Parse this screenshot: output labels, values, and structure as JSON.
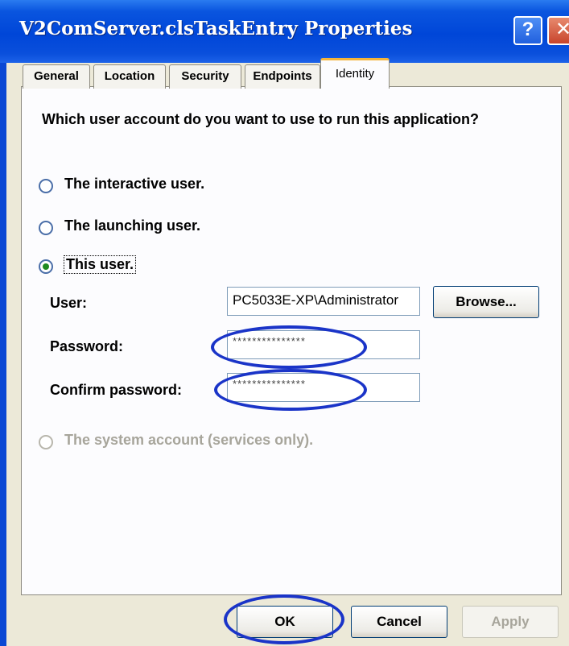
{
  "window": {
    "title": "V2ComServer.clsTaskEntry Properties",
    "help_label": "?",
    "close_label": "✕"
  },
  "tabs": [
    {
      "label": "General",
      "selected": false
    },
    {
      "label": "Location",
      "selected": false
    },
    {
      "label": "Security",
      "selected": false
    },
    {
      "label": "Endpoints",
      "selected": false
    },
    {
      "label": "Identity",
      "selected": true
    }
  ],
  "identity": {
    "question": "Which user account do you want to use to run this application?",
    "options": [
      {
        "label": "The interactive user.",
        "selected": false,
        "enabled": true
      },
      {
        "label": "The launching user.",
        "selected": false,
        "enabled": true
      },
      {
        "label": "This user.",
        "selected": true,
        "enabled": true
      },
      {
        "label": "The system account (services only).",
        "selected": false,
        "enabled": false
      }
    ],
    "user_label": "User:",
    "user_value": "PC5033E-XP\\Administrator",
    "browse_label": "Browse...",
    "password_label": "Password:",
    "password_value": "***************",
    "confirm_label": "Confirm password:",
    "confirm_value": "***************"
  },
  "buttons": {
    "ok": "OK",
    "cancel": "Cancel",
    "apply": "Apply"
  },
  "colors": {
    "titlebar": "#0046d8",
    "annotation_circle": "#1a34c8",
    "active_tab_accent": "#f5b53a"
  }
}
